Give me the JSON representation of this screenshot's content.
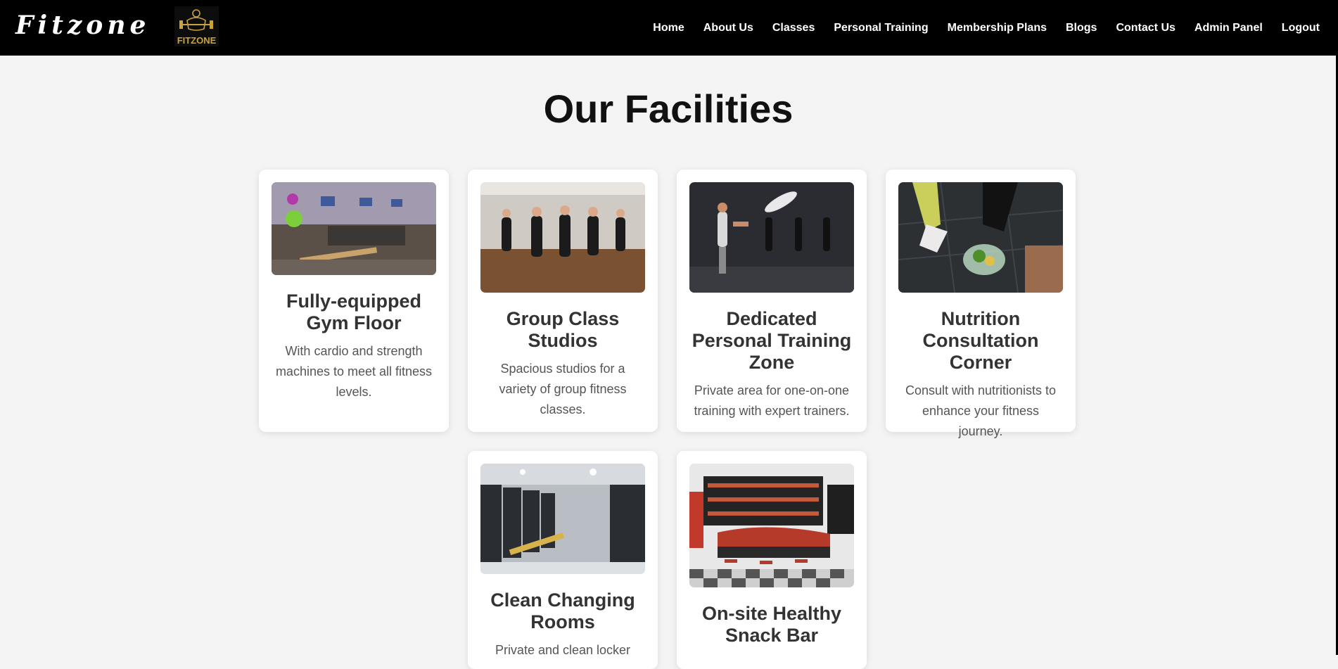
{
  "navbar": {
    "brand_text": "Fitzone",
    "logo_text": "FITZONE",
    "links": [
      "Home",
      "About Us",
      "Classes",
      "Personal Training",
      "Membership Plans",
      "Blogs",
      "Contact Us",
      "Admin Panel",
      "Logout"
    ]
  },
  "page": {
    "title": "Our Facilities"
  },
  "facilities": [
    {
      "title": "Fully-equipped Gym Floor",
      "desc": "With cardio and strength machines to meet all fitness levels."
    },
    {
      "title": "Group Class Studios",
      "desc": "Spacious studios for a variety of group fitness classes."
    },
    {
      "title": "Dedicated Personal Training Zone",
      "desc": "Private area for one-on-one training with expert trainers."
    },
    {
      "title": "Nutrition Consultation Corner",
      "desc": "Consult with nutritionists to enhance your fitness journey."
    },
    {
      "title": "Clean Changing Rooms",
      "desc": "Private and clean locker"
    },
    {
      "title": "On-site Healthy Snack Bar",
      "desc": ""
    }
  ]
}
